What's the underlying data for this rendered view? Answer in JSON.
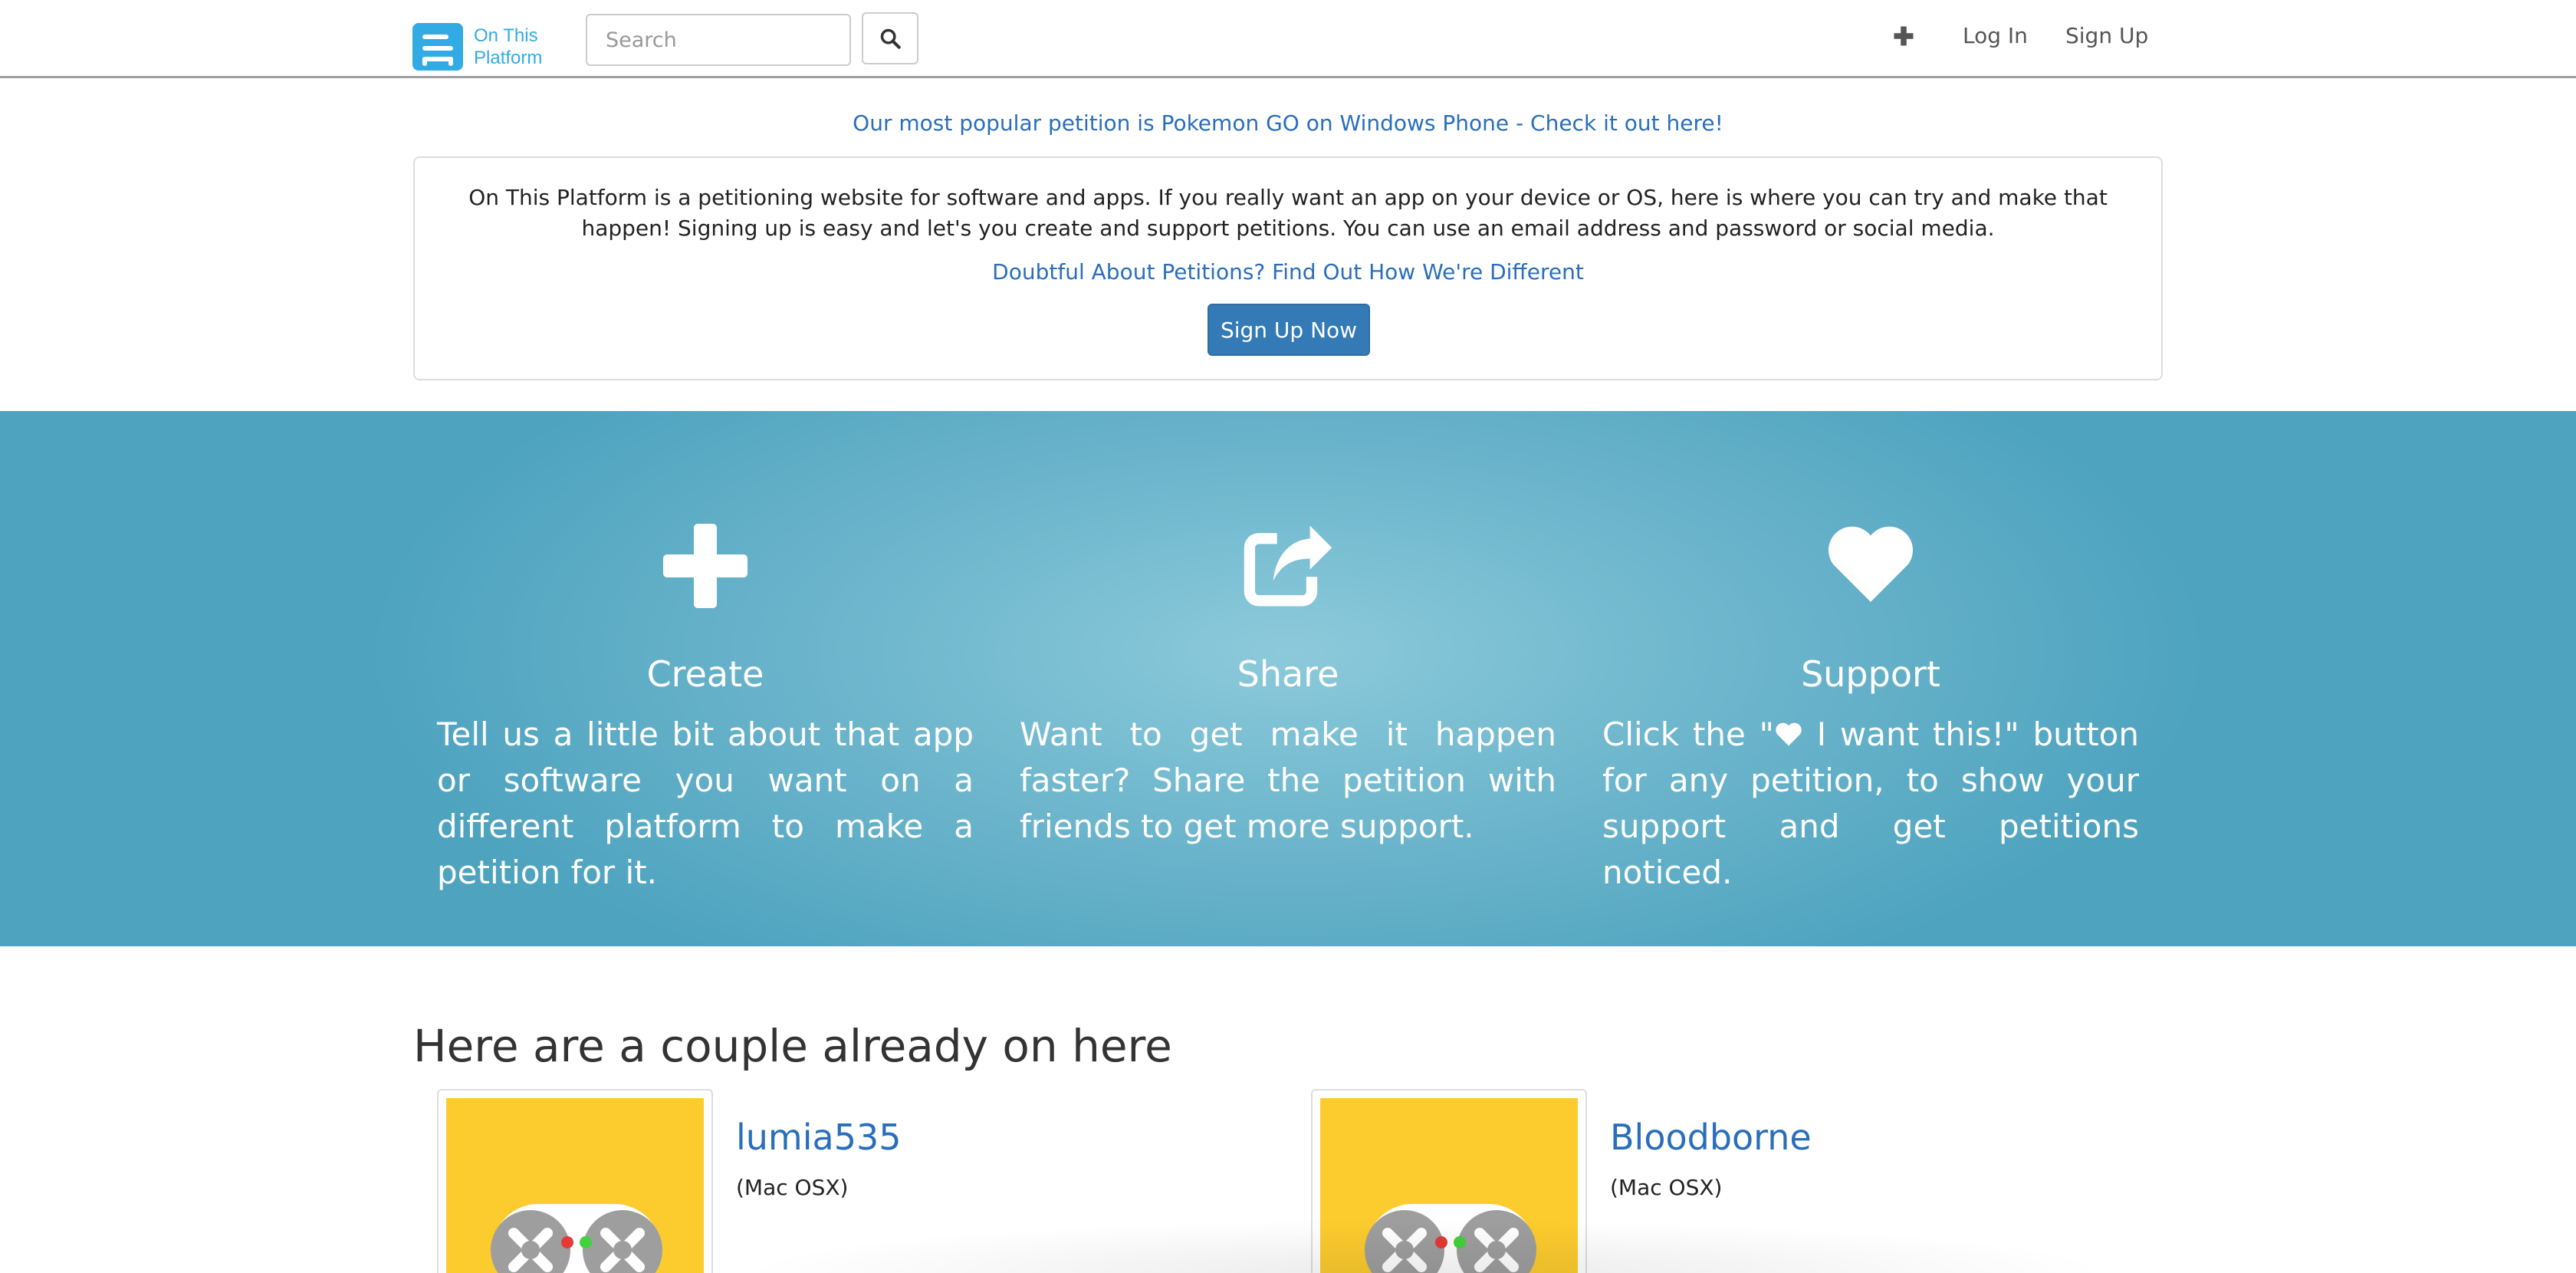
{
  "nav": {
    "brand_line1": "On This",
    "brand_line2": "Platform",
    "search_placeholder": "Search",
    "login": "Log In",
    "signup": "Sign Up"
  },
  "promo": {
    "text": "Our most popular petition is Pokemon GO on Windows Phone - Check it out here!"
  },
  "info": {
    "text": "On This Platform is a petitioning website for software and apps. If you really want an app on your device or OS, here is where you can try and make that happen! Signing up is easy and let's you create and support petitions. You can use an email address and password or social media.",
    "link": "Doubtful About Petitions? Find Out How We're Different",
    "button": "Sign Up Now"
  },
  "features": [
    {
      "icon": "plus-icon",
      "title": "Create",
      "desc": "Tell us a little bit about that app or software you want on a different platform to make a petition for it."
    },
    {
      "icon": "share-icon",
      "title": "Share",
      "desc": "Want to get make it happen faster? Share the petition with friends to get more support."
    },
    {
      "icon": "heart-icon",
      "title": "Support",
      "desc_before": "Click the \"",
      "desc_after": " I want this!\" button for any petition, to show your support and get petitions noticed."
    }
  ],
  "list": {
    "title": "Here are a couple already on here",
    "items": [
      {
        "name": "lumia535",
        "platform": "(Mac OSX)"
      },
      {
        "name": "Bloodborne",
        "platform": "(Mac OSX)"
      }
    ]
  },
  "colors": {
    "brand": "#32abe4",
    "link": "#2a6ebb",
    "button": "#337ab7",
    "hero": "#6fb7cd",
    "thumb": "#fccb2e"
  }
}
